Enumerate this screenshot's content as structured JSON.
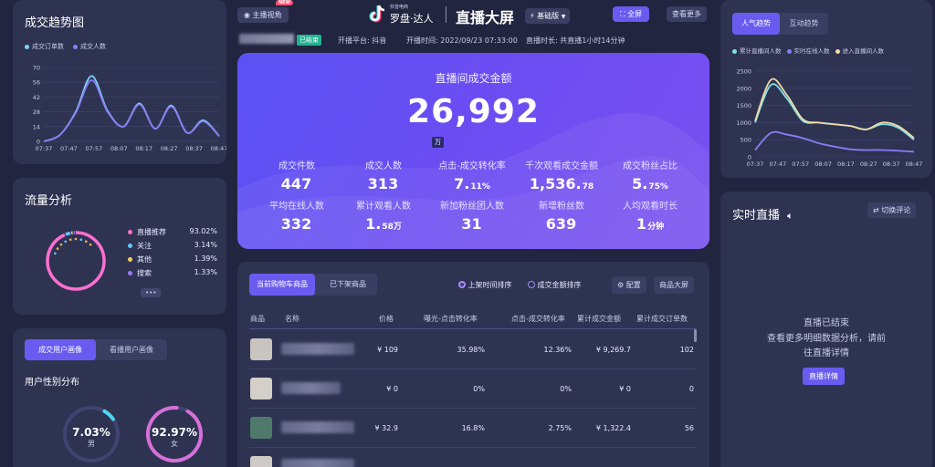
{
  "header": {
    "anchor_view_label": "主播视角",
    "new_badge": "NEW",
    "brand_small": "抖音电商",
    "brand_name": "罗盘·达人",
    "title": "直播大屏",
    "edition_label": "基础版",
    "fullscreen_label": "全屏",
    "view_more_label": "查看更多",
    "status_badge": "已结束",
    "platform": "开播平台: 抖音",
    "start_time": "开播时间: 2022/09/23 07:33:00",
    "duration": "直播时长: 共直播1小时14分钟"
  },
  "deal_trend": {
    "title": "成交趋势图",
    "legend": [
      "成交订单数",
      "成交人数"
    ],
    "colors": [
      "#7fd3f7",
      "#8a7cf6"
    ],
    "chart_data": {
      "type": "line",
      "x": [
        "07:37",
        "07:47",
        "07:57",
        "08:07",
        "08:17",
        "08:27",
        "08:37",
        "08:47"
      ],
      "yticks": [
        0,
        14,
        28,
        42,
        56,
        70
      ],
      "ylim": [
        0,
        70
      ],
      "series": [
        {
          "name": "成交订单数",
          "values": [
            0,
            6,
            28,
            62,
            29,
            14,
            36,
            12,
            34,
            8,
            20,
            5
          ]
        },
        {
          "name": "成交人数",
          "values": [
            0,
            6,
            27,
            58,
            28,
            14,
            35,
            12,
            33,
            8,
            19,
            5
          ]
        }
      ]
    }
  },
  "traffic": {
    "title": "流量分析",
    "items": [
      {
        "label": "直播推荐",
        "value": "93.02%",
        "color": "#ff6fd0"
      },
      {
        "label": "关注",
        "value": "3.14%",
        "color": "#62c9ff"
      },
      {
        "label": "其他",
        "value": "1.39%",
        "color": "#f5d15b"
      },
      {
        "label": "搜索",
        "value": "1.33%",
        "color": "#9a7bff"
      }
    ],
    "more_label": "•••",
    "chart_data": {
      "type": "pie",
      "categories": [
        "直播推荐",
        "关注",
        "其他",
        "搜索"
      ],
      "values": [
        93.02,
        3.14,
        1.39,
        1.33
      ]
    }
  },
  "profile": {
    "tabs": [
      "成交用户画像",
      "看播用户画像"
    ],
    "subtitle": "用户性别分布",
    "male_pct": "7.03%",
    "male_label": "男",
    "female_pct": "92.97%",
    "female_label": "女",
    "male_fraction": 0.0703,
    "female_fraction": 0.9297
  },
  "hero": {
    "title": "直播间成交金额",
    "amount": "26,992",
    "unit": "万",
    "stats": [
      {
        "label": "成交件数",
        "value": "447",
        "suffix": ""
      },
      {
        "label": "成交人数",
        "value": "313",
        "suffix": ""
      },
      {
        "label": "点击-成交转化率",
        "value": "7.",
        "suffix": "11%"
      },
      {
        "label": "千次观看成交金额",
        "value": "1,536.",
        "suffix": "78"
      },
      {
        "label": "成交粉丝占比",
        "value": "5.",
        "suffix": "75%"
      },
      {
        "label": "平均在线人数",
        "value": "332",
        "suffix": ""
      },
      {
        "label": "累计观看人数",
        "value": "1.",
        "suffix": "58万"
      },
      {
        "label": "新加粉丝团人数",
        "value": "31",
        "suffix": ""
      },
      {
        "label": "新增粉丝数",
        "value": "639",
        "suffix": ""
      },
      {
        "label": "人均观看时长",
        "value": "1",
        "suffix": "分钟"
      }
    ]
  },
  "products": {
    "tabs": [
      "当前购物车商品",
      "已下架商品"
    ],
    "sort_options": [
      "上架时间排序",
      "成交金额排序"
    ],
    "config_label": "配置",
    "screen_label": "商品大屏",
    "headers": [
      "商品",
      "名称",
      "价格",
      "曝光-点击转化率",
      "点击-成交转化率",
      "累计成交金额",
      "累计成交订单数"
    ],
    "rows": [
      {
        "price": "¥ 109",
        "exp_click": "35.98%",
        "click_deal": "12.36%",
        "gmv": "¥ 9,269.7",
        "orders": "102",
        "thumb": "#c9c4c0"
      },
      {
        "price": "¥ 0",
        "exp_click": "0%",
        "click_deal": "0%",
        "gmv": "¥ 0",
        "orders": "0",
        "thumb": "#d4cfc8"
      },
      {
        "price": "¥ 32.9",
        "exp_click": "16.8%",
        "click_deal": "2.75%",
        "gmv": "¥ 1,322.4",
        "orders": "56",
        "thumb": "#4f7a6b"
      }
    ]
  },
  "popularity": {
    "tabs": [
      "人气趋势",
      "互动趋势"
    ],
    "legend": [
      "累计直播间人数",
      "实时在线人数",
      "进入直播间人数"
    ],
    "colors": [
      "#7fe3e8",
      "#8a7cf6",
      "#f3d9a4"
    ],
    "chart_data": {
      "type": "line",
      "x": [
        "07:37",
        "07:47",
        "07:57",
        "08:07",
        "08:17",
        "08:27",
        "08:37",
        "08:47"
      ],
      "yticks": [
        0,
        500,
        1000,
        1500,
        2000,
        2500
      ],
      "ylim": [
        0,
        2500
      ],
      "series": [
        {
          "name": "累计直播间人数",
          "values": [
            1000,
            2100,
            1700,
            1050,
            1000,
            950,
            900,
            800,
            950,
            850,
            500
          ]
        },
        {
          "name": "实时在线人数",
          "values": [
            200,
            700,
            650,
            550,
            400,
            300,
            220,
            200,
            200,
            180,
            150
          ]
        },
        {
          "name": "进入直播间人数",
          "values": [
            1050,
            2250,
            1800,
            1100,
            1000,
            950,
            900,
            800,
            1000,
            900,
            550
          ]
        }
      ]
    }
  },
  "live": {
    "title": "实时直播",
    "switch_label": "切换评论",
    "ended": "直播已结束",
    "hint_line1": "查看更多明细数据分析，请前",
    "hint_line2": "往直播详情",
    "detail_button": "直播详情"
  }
}
